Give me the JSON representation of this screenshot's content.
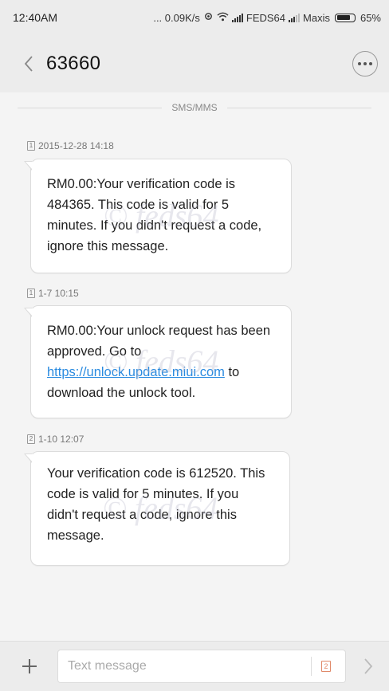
{
  "status_bar": {
    "time": "12:40AM",
    "network_speed": "... 0.09K/s",
    "carrier_1": "FEDS64",
    "carrier_2": "Maxis",
    "battery": "65%"
  },
  "header": {
    "title": "63660"
  },
  "divider_label": "SMS/MMS",
  "messages": [
    {
      "sim": "1",
      "time": "2015-12-28 14:18",
      "text": "RM0.00:Your verification code is 484365. This code is valid for 5 minutes. If you didn't request a code, ignore this message."
    },
    {
      "sim": "1",
      "time": "1-7 10:15",
      "text_before": "RM0.00:Your unlock request has been approved. Go to ",
      "link": "https://unlock.update.miui.com",
      "text_after": " to download the unlock tool."
    },
    {
      "sim": "2",
      "time": "1-10 12:07",
      "text": "Your verification code is 612520. This code is valid for 5 minutes. If you didn't request a code, ignore this message."
    }
  ],
  "watermark": "© feds64",
  "compose": {
    "placeholder": "Text message",
    "sim_badge": "2"
  },
  "icons": {
    "back": "chevron-left-icon",
    "more": "more-dots-icon",
    "add": "plus-icon",
    "send": "chevron-right-icon"
  }
}
